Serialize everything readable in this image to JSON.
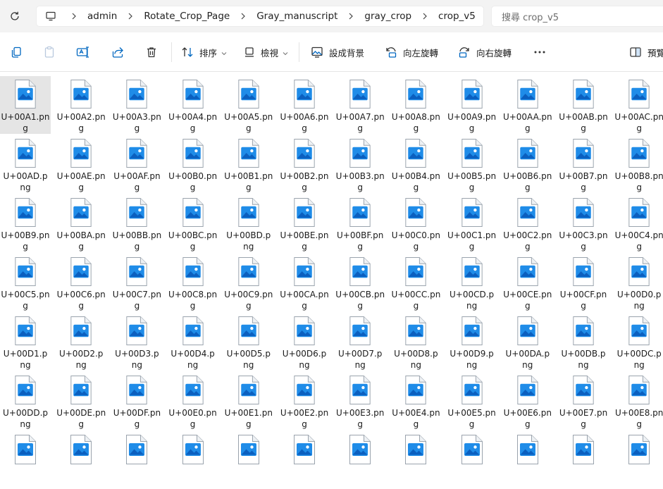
{
  "address_bar": {
    "crumbs": [
      "admin",
      "Rotate_Crop_Page",
      "Gray_manuscript",
      "gray_crop",
      "crop_v5"
    ],
    "search_placeholder": "搜尋 crop_v5"
  },
  "toolbar": {
    "sort_label": "排序",
    "view_label": "檢視",
    "set_background_label": "設成背景",
    "rotate_left_label": "向左旋轉",
    "rotate_right_label": "向右旋轉",
    "preview_label": "預覽"
  },
  "files": [
    "U+00A1.png",
    "U+00A2.png",
    "U+00A3.png",
    "U+00A4.png",
    "U+00A5.png",
    "U+00A6.png",
    "U+00A7.png",
    "U+00A8.png",
    "U+00A9.png",
    "U+00AA.png",
    "U+00AB.png",
    "U+00AC.png",
    "U+00AD.png",
    "U+00AE.png",
    "U+00AF.png",
    "U+00B0.png",
    "U+00B1.png",
    "U+00B2.png",
    "U+00B3.png",
    "U+00B4.png",
    "U+00B5.png",
    "U+00B6.png",
    "U+00B7.png",
    "U+00B8.png",
    "U+00B9.png",
    "U+00BA.png",
    "U+00BB.png",
    "U+00BC.png",
    "U+00BD.png",
    "U+00BE.png",
    "U+00BF.png",
    "U+00C0.png",
    "U+00C1.png",
    "U+00C2.png",
    "U+00C3.png",
    "U+00C4.png",
    "U+00C5.png",
    "U+00C6.png",
    "U+00C7.png",
    "U+00C8.png",
    "U+00C9.png",
    "U+00CA.png",
    "U+00CB.png",
    "U+00CC.png",
    "U+00CD.png",
    "U+00CE.png",
    "U+00CF.png",
    "U+00D0.png",
    "U+00D1.png",
    "U+00D2.png",
    "U+00D3.png",
    "U+00D4.png",
    "U+00D5.png",
    "U+00D6.png",
    "U+00D7.png",
    "U+00D8.png",
    "U+00D9.png",
    "U+00DA.png",
    "U+00DB.png",
    "U+00DC.png",
    "U+00DD.png",
    "U+00DE.png",
    "U+00DF.png",
    "U+00E0.png",
    "U+00E1.png",
    "U+00E2.png",
    "U+00E3.png",
    "U+00E4.png",
    "U+00E5.png",
    "U+00E6.png",
    "U+00E7.png",
    "U+00E8.png"
  ],
  "partial_row_icon_count": 12,
  "selected_file": "U+00A1.png",
  "colors": {
    "accent": "#0067c0",
    "selection": "#e5e5e5",
    "image_icon_blue": "#1f8ce8"
  }
}
